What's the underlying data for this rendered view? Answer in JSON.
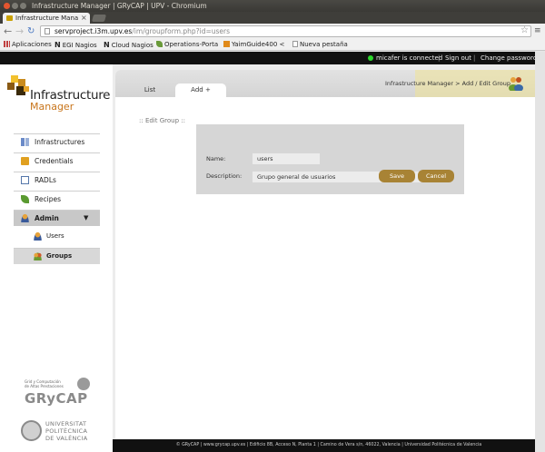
{
  "window": {
    "title": "Infrastructure Manager | GRyCAP | UPV - Chromium"
  },
  "tab": {
    "title": "Infrastructure Mana",
    "close": "×"
  },
  "toolbar": {
    "url_host": "servproject.i3m.upv.es",
    "url_path": "/im/groupform.php?id=users"
  },
  "bookmarks": [
    {
      "label": "Aplicaciones",
      "icon": "apps-grid-icon",
      "color": "#c04040"
    },
    {
      "label": "EGI Nagios",
      "icon": "nagios-icon",
      "color": "#111111"
    },
    {
      "label": "Cloud Nagios",
      "icon": "nagios-icon",
      "color": "#111111"
    },
    {
      "label": "Operations-Porta",
      "icon": "operations-leaf-icon",
      "color": "#6a9a3a"
    },
    {
      "label": "YaimGuide400 <",
      "icon": "yaim-icon",
      "color": "#e08a1a"
    },
    {
      "label": "Nueva pestaña",
      "icon": "page-icon",
      "color": "#ffffff"
    }
  ],
  "topbar": {
    "connected": "micafer is connected",
    "sep": "|",
    "sign_out": "Sign out",
    "change_password": "Change password",
    "status_color": "#2cd82c"
  },
  "logo": {
    "title": "Infrastructure",
    "subtitle": "Manager"
  },
  "nav": [
    {
      "key": "infrastructures",
      "label": "Infrastructures",
      "icon": "infrastructure-icon"
    },
    {
      "key": "credentials",
      "label": "Credentials",
      "icon": "folder-icon"
    },
    {
      "key": "radls",
      "label": "RADLs",
      "icon": "document-icon"
    },
    {
      "key": "recipes",
      "label": "Recipes",
      "icon": "recipe-leaf-icon"
    },
    {
      "key": "admin",
      "label": "Admin",
      "icon": "admin-user-icon",
      "arrow": "▼"
    },
    {
      "key": "users",
      "label": "Users",
      "icon": "user-icon"
    },
    {
      "key": "groups",
      "label": "Groups",
      "icon": "group-icon"
    }
  ],
  "content": {
    "tabs": {
      "list": "List",
      "add": "Add +"
    },
    "breadcrumb": "Infrastructure Manager > Add / Edit Group",
    "section_title": ":: Edit Group ::"
  },
  "form": {
    "name_label": "Name:",
    "name_value": "users",
    "description_label": "Description:",
    "description_value": "Grupo general de usuarios",
    "save": "Save",
    "cancel": "Cancel"
  },
  "sidebar_footer": {
    "grycap_line1": "Grid y Computación",
    "grycap_line2": "de Altas Prestaciones",
    "grycap_word": "GRyCAP",
    "upv_line1": "UNIVERSITAT",
    "upv_line2": "POLITÈCNICA",
    "upv_line3": "DE VALÈNCIA"
  },
  "footer": {
    "text": "© GRyCAP  |  www.grycap.upv.es  |  Edificio 8B, Acceso N, Planta 1  |  Camino de Vera s/n, 46022, Valencia  |  Universidad Politécnica de Valencia"
  },
  "colors": {
    "accent_button": "#a88335",
    "logo_subtitle": "#c8741a"
  }
}
